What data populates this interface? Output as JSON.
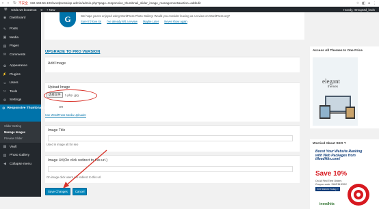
{
  "browser": {
    "security_label": "不安全",
    "url": "192.168.56.103/wordpress/wp-admin/admin.php?page=responsive_thumbnail_slider_image_management&action=addedit"
  },
  "adminbar": {
    "site": "tchde.ws boot2root",
    "comments": "0",
    "new_label": "+ New",
    "howdy": "Howdy, r0mupt3d_bsdn"
  },
  "sidebar": {
    "items": [
      {
        "label": "Dashboard",
        "icon": "dashboard-icon"
      },
      {
        "label": "Posts",
        "icon": "pin-icon"
      },
      {
        "label": "Media",
        "icon": "media-icon"
      },
      {
        "label": "Pages",
        "icon": "pages-icon"
      },
      {
        "label": "Comments",
        "icon": "comment-icon"
      },
      {
        "label": "Appearance",
        "icon": "brush-icon"
      },
      {
        "label": "Plugins",
        "icon": "plug-icon"
      },
      {
        "label": "Users",
        "icon": "user-icon"
      },
      {
        "label": "Tools",
        "icon": "wrench-icon"
      },
      {
        "label": "Settings",
        "icon": "settings-icon"
      }
    ],
    "active_label": "Responsive Thumbnail Slider",
    "sub_items": [
      "Slider Setting",
      "Manage Images",
      "Preview Slider"
    ],
    "after_items": [
      {
        "label": "Vault",
        "icon": "vault-icon"
      },
      {
        "label": "Photo Gallery",
        "icon": "gallery-icon"
      },
      {
        "label": "Collapse menu",
        "icon": "collapse-icon"
      }
    ]
  },
  "notice": {
    "message": "We hope you've enjoyed using WordPress Photo Gallery! Would you consider leaving us a review on WordPress.org?",
    "links": [
      "Sure! I'd love to!",
      "I've already left a review",
      "Maybe Later",
      "Never show again"
    ]
  },
  "main": {
    "upgrade": "UPGRADE TO PRO VERSION",
    "add_image": "Add Image",
    "upload_label": "Upload Image",
    "choose_button": "选择文件",
    "file_name": "1.php .jpg",
    "or": "OR",
    "media_uploader": "Use WordPress Media Uploader",
    "image_title_label": "Image Title",
    "image_title_help": "Used in image alt for seo",
    "image_url_label": "Image Url(On click redirect to this url.)",
    "image_url_help": "On image click users will redirect to this url.",
    "save_button": "Save Changes",
    "cancel_button": "Cancel"
  },
  "right": {
    "themes_heading": "Access All Themes In One Price",
    "themes_brand": "elegant",
    "themes_sub": "themes",
    "seo_heading": "Worried About SEO ?",
    "seo_line1": "Boost Your Website Ranking with Web Packages from iNeedHits.com!",
    "seo_line2": "Save 10%",
    "seo_line3": "On All First Time Orders",
    "seo_code": "Coupon code: SAVENH2012",
    "seo_go": "Get Started Today »",
    "seo_brand": "ineedhits"
  }
}
